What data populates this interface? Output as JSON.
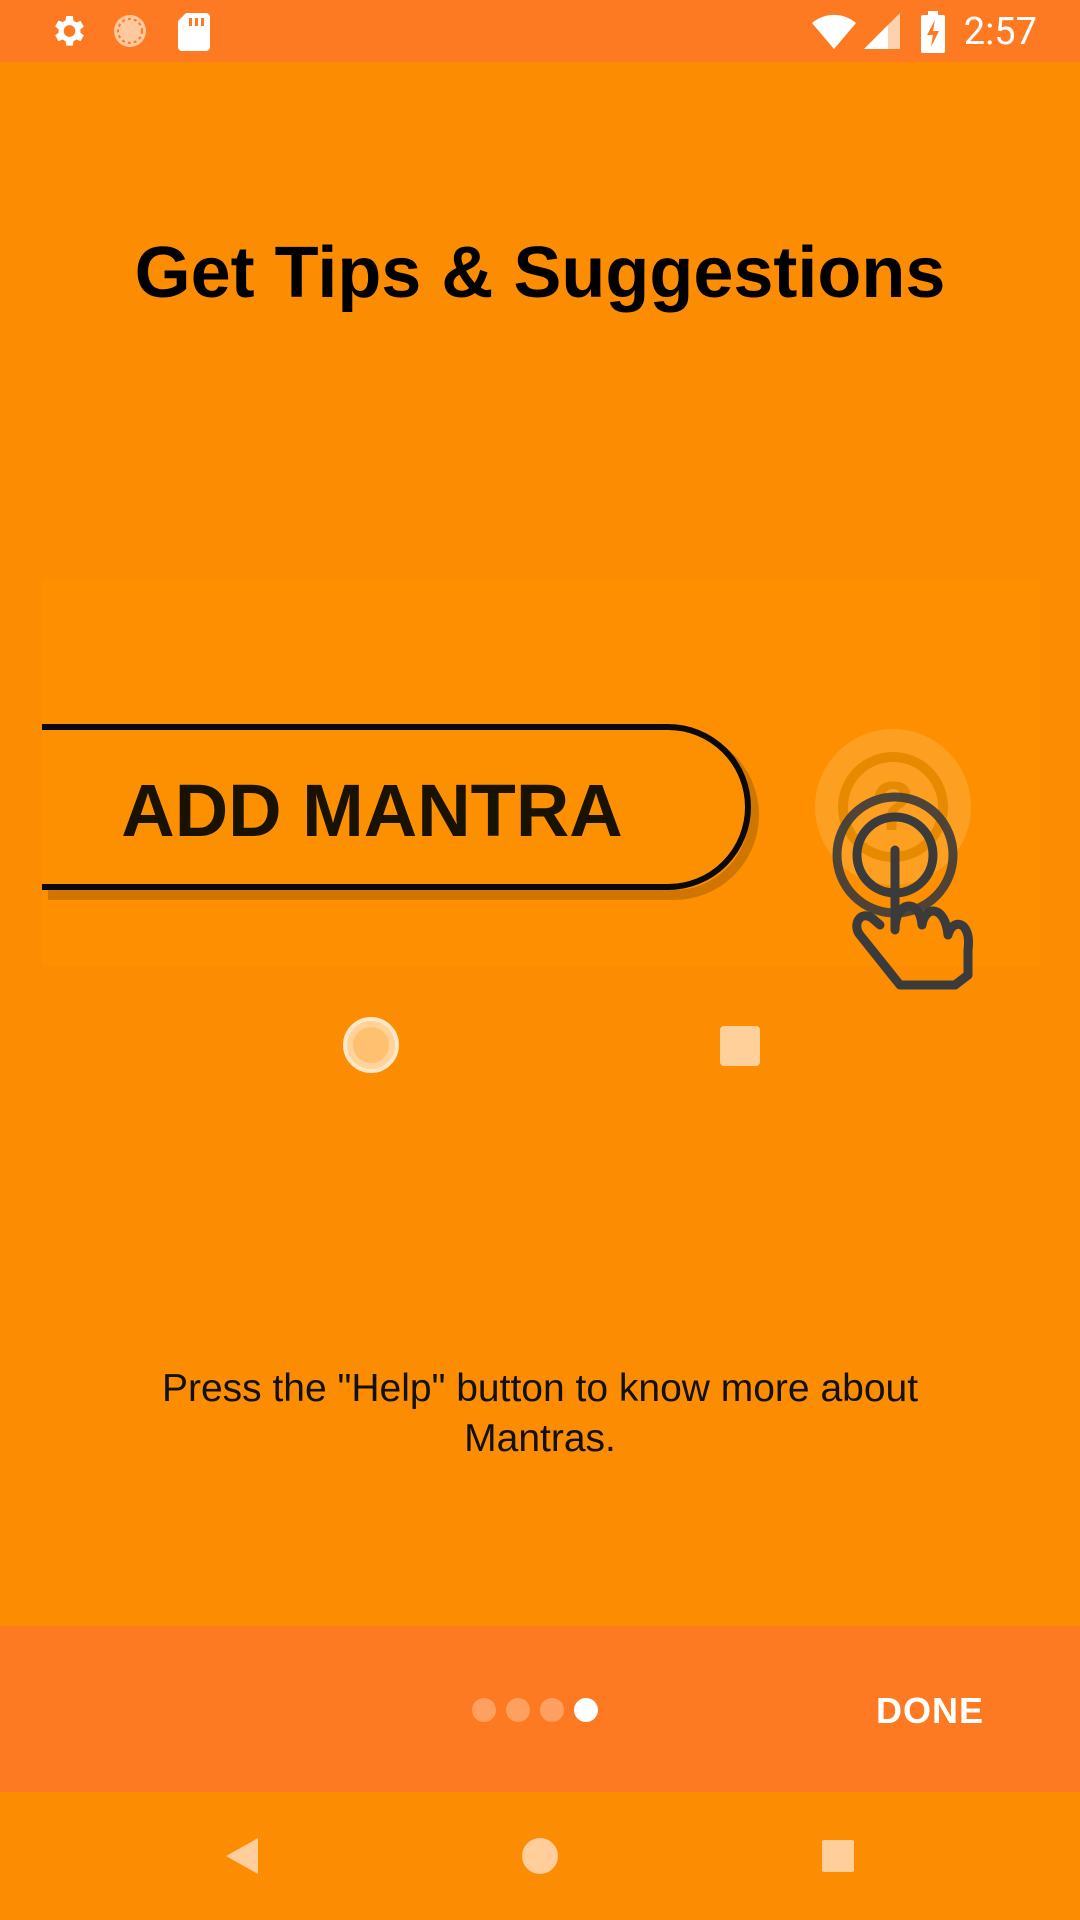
{
  "status_bar": {
    "time": "2:57",
    "icons": [
      "gear-icon",
      "loading-icon",
      "sd-card-icon",
      "wifi-icon",
      "signal-icon",
      "battery-charging-icon"
    ]
  },
  "onboarding": {
    "title": "Get Tips & Suggestions",
    "illustration": {
      "button_label": "ADD MANTRA",
      "icons": [
        "help-icon",
        "tap-hand-icon"
      ]
    },
    "description": "Press the \"Help\" button to know more about Mantras."
  },
  "pager": {
    "page_count": 4,
    "current_page": 4
  },
  "bottom_bar": {
    "done_label": "DONE"
  },
  "nav_bar": {
    "icons": [
      "back-icon",
      "home-icon",
      "recents-icon"
    ]
  },
  "colors": {
    "background": "#FC8C02",
    "status_bar": "#FE7A22",
    "bottom_bar": "#FE7A22",
    "text_dark": "#000000",
    "text_light": "#FFFFFF"
  }
}
